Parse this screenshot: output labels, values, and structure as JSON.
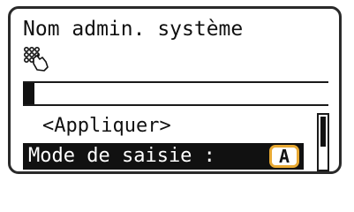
{
  "screen": {
    "title": "Nom admin. système",
    "touch_icon": "keypad-touch-icon"
  },
  "input": {
    "value": ""
  },
  "menu": {
    "apply_label": "<Appliquer>",
    "mode_label": "Mode de saisie :",
    "mode_value": "A"
  },
  "colors": {
    "highlight_badge": "#e8a933",
    "selection_bg": "#111111"
  }
}
